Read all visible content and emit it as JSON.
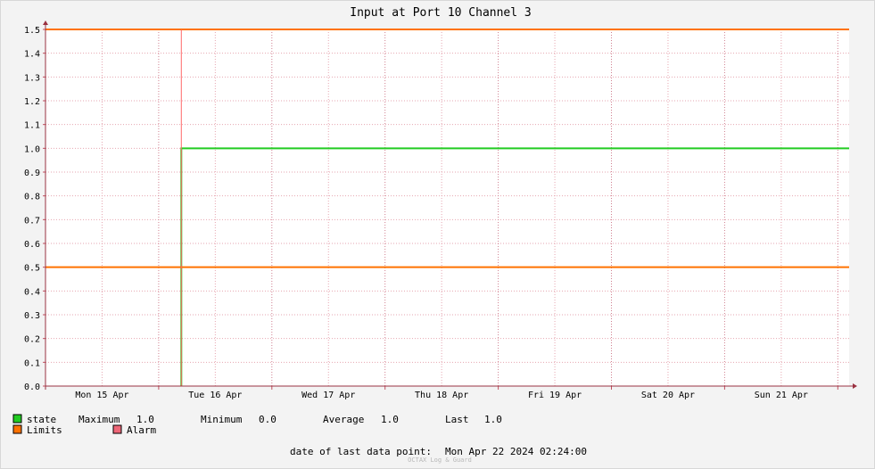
{
  "chart_data": {
    "type": "line",
    "title": "Input at Port 10 Channel 3",
    "xlabel": "",
    "ylabel": "",
    "ylim": [
      0,
      1.5
    ],
    "yticks": [
      "0.0",
      "0.1",
      "0.2",
      "0.3",
      "0.4",
      "0.5",
      "0.6",
      "0.7",
      "0.8",
      "0.9",
      "1.0",
      "1.1",
      "1.2",
      "1.3",
      "1.4",
      "1.5"
    ],
    "x_categories": [
      "Mon 15 Apr",
      "Tue 16 Apr",
      "Wed 17 Apr",
      "Thu 18 Apr",
      "Fri 19 Apr",
      "Sat 20 Apr",
      "Sun 21 Apr"
    ],
    "xlim_days": [
      0,
      7.1
    ],
    "grid": true,
    "series": [
      {
        "name": "state",
        "color": "#22cc22",
        "points": [
          [
            1.2,
            0.0
          ],
          [
            1.2,
            1.0
          ],
          [
            7.1,
            1.0
          ]
        ]
      },
      {
        "name": "Limits",
        "color": "#ff7200",
        "levels": [
          0.5,
          1.5
        ]
      },
      {
        "name": "Alarm",
        "color": "#ff6666",
        "events": [
          1.2
        ]
      }
    ]
  },
  "legend": {
    "state": {
      "label": "state",
      "color": "#22cc22",
      "stats": [
        {
          "label": "Maximum",
          "value": "1.0"
        },
        {
          "label": "Minimum",
          "value": "0.0"
        },
        {
          "label": "Average",
          "value": "1.0"
        },
        {
          "label": "Last",
          "value": "1.0"
        }
      ]
    },
    "limits": {
      "label": "Limits",
      "color": "#ff7200"
    },
    "alarm": {
      "label": "Alarm",
      "color": "#ee6677"
    }
  },
  "footer": {
    "last_point_label": "date of last data point:",
    "last_point_value": "Mon Apr 22 2024 02:24:00",
    "watermark": "OCTAX Log & Guard"
  }
}
